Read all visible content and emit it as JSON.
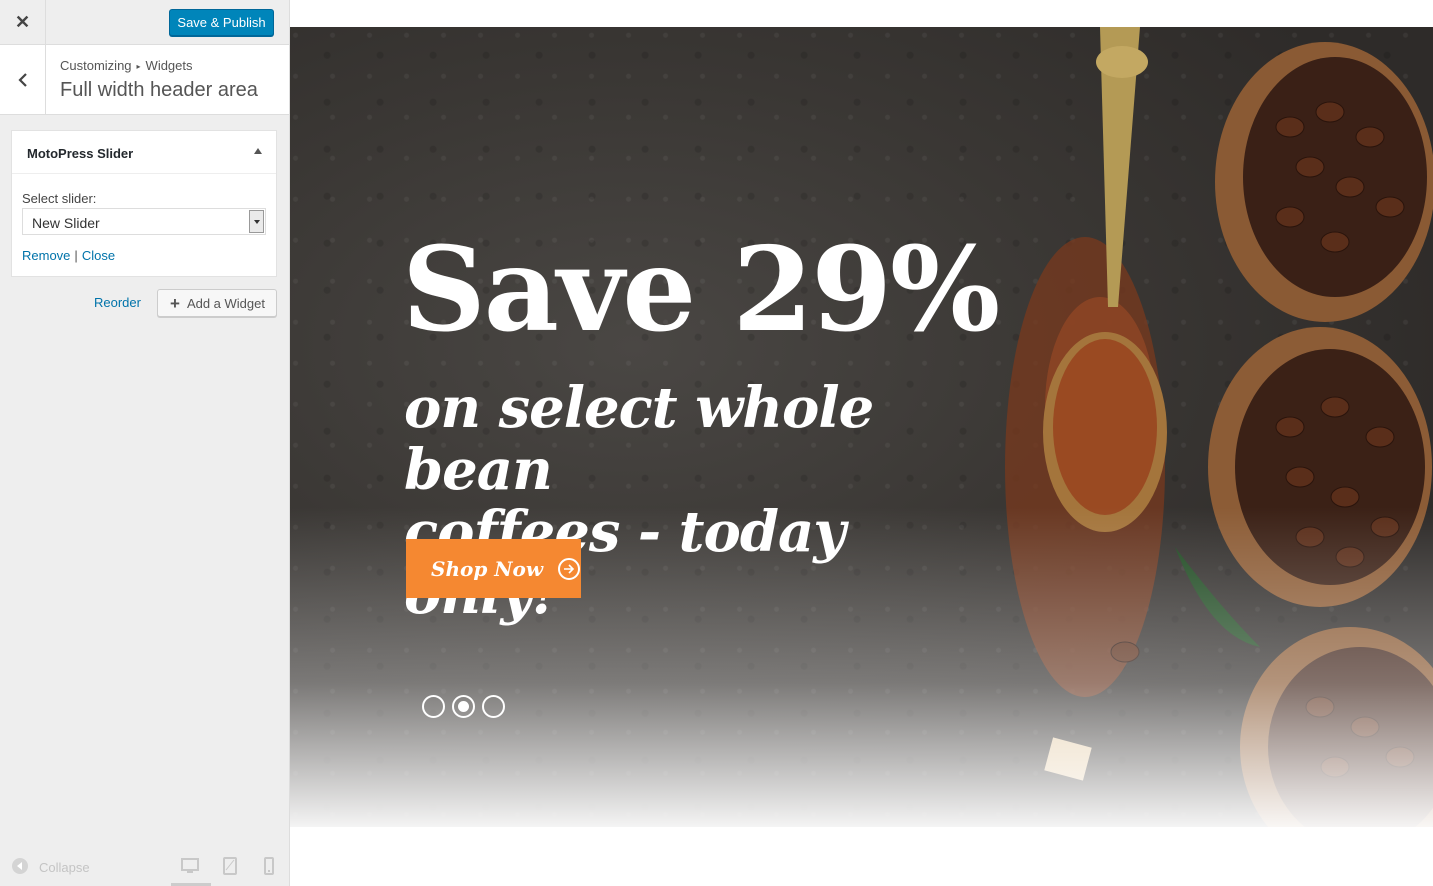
{
  "topbar": {
    "close_icon": "close-icon",
    "publish_label": "Save & Publish"
  },
  "section": {
    "breadcrumb_root": "Customizing",
    "breadcrumb_current": "Widgets",
    "title": "Full width header area"
  },
  "widget": {
    "title": "MotoPress Slider",
    "select_label": "Select slider:",
    "selected_slider": "New Slider",
    "remove_label": "Remove",
    "separator": "|",
    "close_label": "Close"
  },
  "actions": {
    "reorder_label": "Reorder",
    "add_widget_label": "Add a Widget"
  },
  "footer": {
    "collapse_label": "Collapse",
    "devices": [
      "desktop-icon",
      "tablet-icon",
      "mobile-icon"
    ]
  },
  "slide": {
    "headline": "Save 29%",
    "subheadline_line1": "on select whole bean",
    "subheadline_line2": "coffees - today only!",
    "cta_label": "Shop Now",
    "slide_count": 3,
    "active_slide": 2
  },
  "colors": {
    "primary_button": "#0085ba",
    "link": "#0073aa",
    "cta": "#f58831"
  }
}
